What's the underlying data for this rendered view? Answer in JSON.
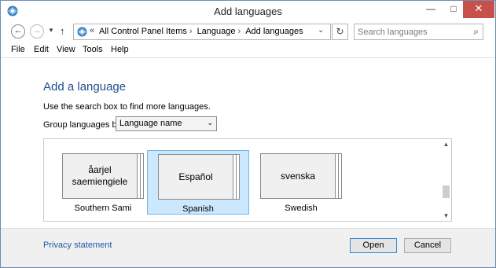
{
  "window": {
    "title": "Add languages",
    "controls": {
      "minimize": "—",
      "maximize": "□",
      "close": "✕"
    }
  },
  "nav": {
    "back": "←",
    "forward": "→",
    "recent": "▼",
    "up": "↑",
    "address_prefix": "«",
    "breadcrumbs": [
      "All Control Panel Items",
      "Language",
      "Add languages"
    ],
    "breadcrumb_separator": "›",
    "address_dropdown": "⌄",
    "refresh": "↻",
    "search_placeholder": "Search languages",
    "search_icon": "⌕"
  },
  "menu": {
    "items": [
      "File",
      "Edit",
      "View",
      "Tools",
      "Help"
    ]
  },
  "main": {
    "title": "Add a language",
    "hint": "Use the search box to find more languages.",
    "group_label": "Group languages by:",
    "group_selected": "Language name",
    "group_chevron": "⌄",
    "languages": [
      {
        "tile": "åarjel saemiengiele",
        "name": "Southern Sami",
        "selected": false
      },
      {
        "tile": "Español",
        "name": "Spanish",
        "selected": true
      },
      {
        "tile": "svenska",
        "name": "Swedish",
        "selected": false
      }
    ],
    "scroll_up": "▲",
    "scroll_down": "▼",
    "scroll_position": 0.8
  },
  "footer": {
    "privacy": "Privacy statement",
    "open": "Open",
    "cancel": "Cancel"
  },
  "colors": {
    "accent": "#1e4f8c",
    "link": "#1e5aa8",
    "selection": "#cce8ff",
    "close": "#c7504b"
  }
}
